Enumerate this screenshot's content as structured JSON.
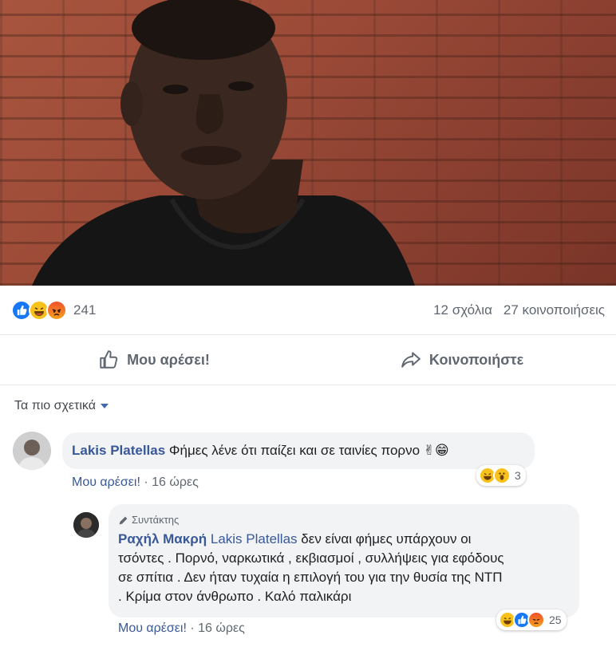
{
  "post": {
    "reactions_count": "241",
    "comments_count": "12 σχόλια",
    "shares_count": "27 κοινοποιήσεις"
  },
  "actions": {
    "like_label": "Μου αρέσει!",
    "share_label": "Κοινοποιήστε"
  },
  "comments_sort": {
    "label": "Τα πιο σχετικά"
  },
  "comments": [
    {
      "author": "Lakis Platellas",
      "text": "Φήμες λένε ότι παίζει και σε ταινίες πορνο ✌😁",
      "like_label": "Μου αρέσει!",
      "separator": "·",
      "time": "16 ώρες",
      "reaction_count": "3"
    }
  ],
  "replies": [
    {
      "badge": "Συντάκτης",
      "author": "Ραχήλ Μακρή",
      "mention": "Lakis Platellas",
      "text_line1": "δεν είναι φήμες υπάρχουν οι",
      "text_line2": "τσόντες . Πορνό, ναρκωτικά , εκβιασμοί , συλλήψεις για εφόδους",
      "text_line3": "σε σπίτια . Δεν ήταν τυχαία η επιλογή του για την θυσία της ΝΤΠ",
      "text_line4": ". Κρίμα στον άνθρωπο . Καλό παλικάρι",
      "like_label": "Μου αρέσει!",
      "separator": "·",
      "time": "16 ώρες",
      "reaction_count": "25"
    }
  ]
}
